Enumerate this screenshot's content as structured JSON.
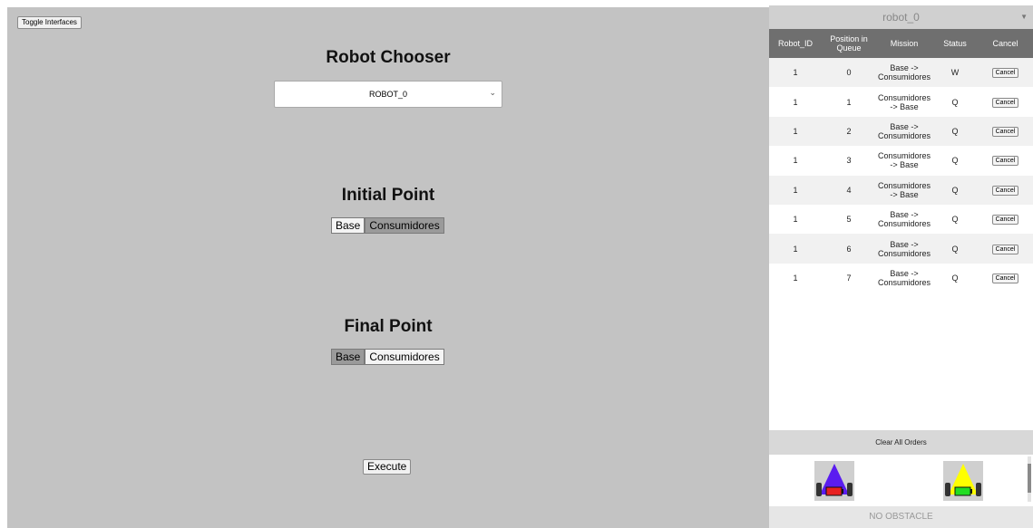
{
  "toolbar": {
    "toggle_label": "Toggle Interfaces"
  },
  "robot_chooser": {
    "title": "Robot Chooser",
    "selected": "ROBOT_0"
  },
  "initial_point": {
    "title": "Initial Point",
    "options": [
      "Base",
      "Consumidores"
    ],
    "selected": "Consumidores"
  },
  "final_point": {
    "title": "Final Point",
    "options": [
      "Base",
      "Consumidores"
    ],
    "selected": "Base"
  },
  "execute_label": "Execute",
  "queue_panel": {
    "robot_name": "robot_0",
    "headers": [
      "Robot_ID",
      "Position in Queue",
      "Mission",
      "Status",
      "Cancel"
    ],
    "rows": [
      {
        "robot_id": "1",
        "position": "0",
        "mission": "Base -> Consumidores",
        "status": "W",
        "cancel": "Cancel"
      },
      {
        "robot_id": "1",
        "position": "1",
        "mission": "Consumidores -> Base",
        "status": "Q",
        "cancel": "Cancel"
      },
      {
        "robot_id": "1",
        "position": "2",
        "mission": "Base -> Consumidores",
        "status": "Q",
        "cancel": "Cancel"
      },
      {
        "robot_id": "1",
        "position": "3",
        "mission": "Consumidores -> Base",
        "status": "Q",
        "cancel": "Cancel"
      },
      {
        "robot_id": "1",
        "position": "4",
        "mission": "Consumidores -> Base",
        "status": "Q",
        "cancel": "Cancel"
      },
      {
        "robot_id": "1",
        "position": "5",
        "mission": "Base -> Consumidores",
        "status": "Q",
        "cancel": "Cancel"
      },
      {
        "robot_id": "1",
        "position": "6",
        "mission": "Base -> Consumidores",
        "status": "Q",
        "cancel": "Cancel"
      },
      {
        "robot_id": "1",
        "position": "7",
        "mission": "Base -> Consumidores",
        "status": "Q",
        "cancel": "Cancel"
      }
    ],
    "clear_label": "Clear All Orders",
    "robots": [
      {
        "icon": "robot-icon",
        "color": "#5a1cf0",
        "battery_color": "#e82020"
      },
      {
        "icon": "robot-icon",
        "color": "#ffff00",
        "battery_color": "#22dd22"
      }
    ],
    "obstacle_status": "NO OBSTACLE"
  }
}
